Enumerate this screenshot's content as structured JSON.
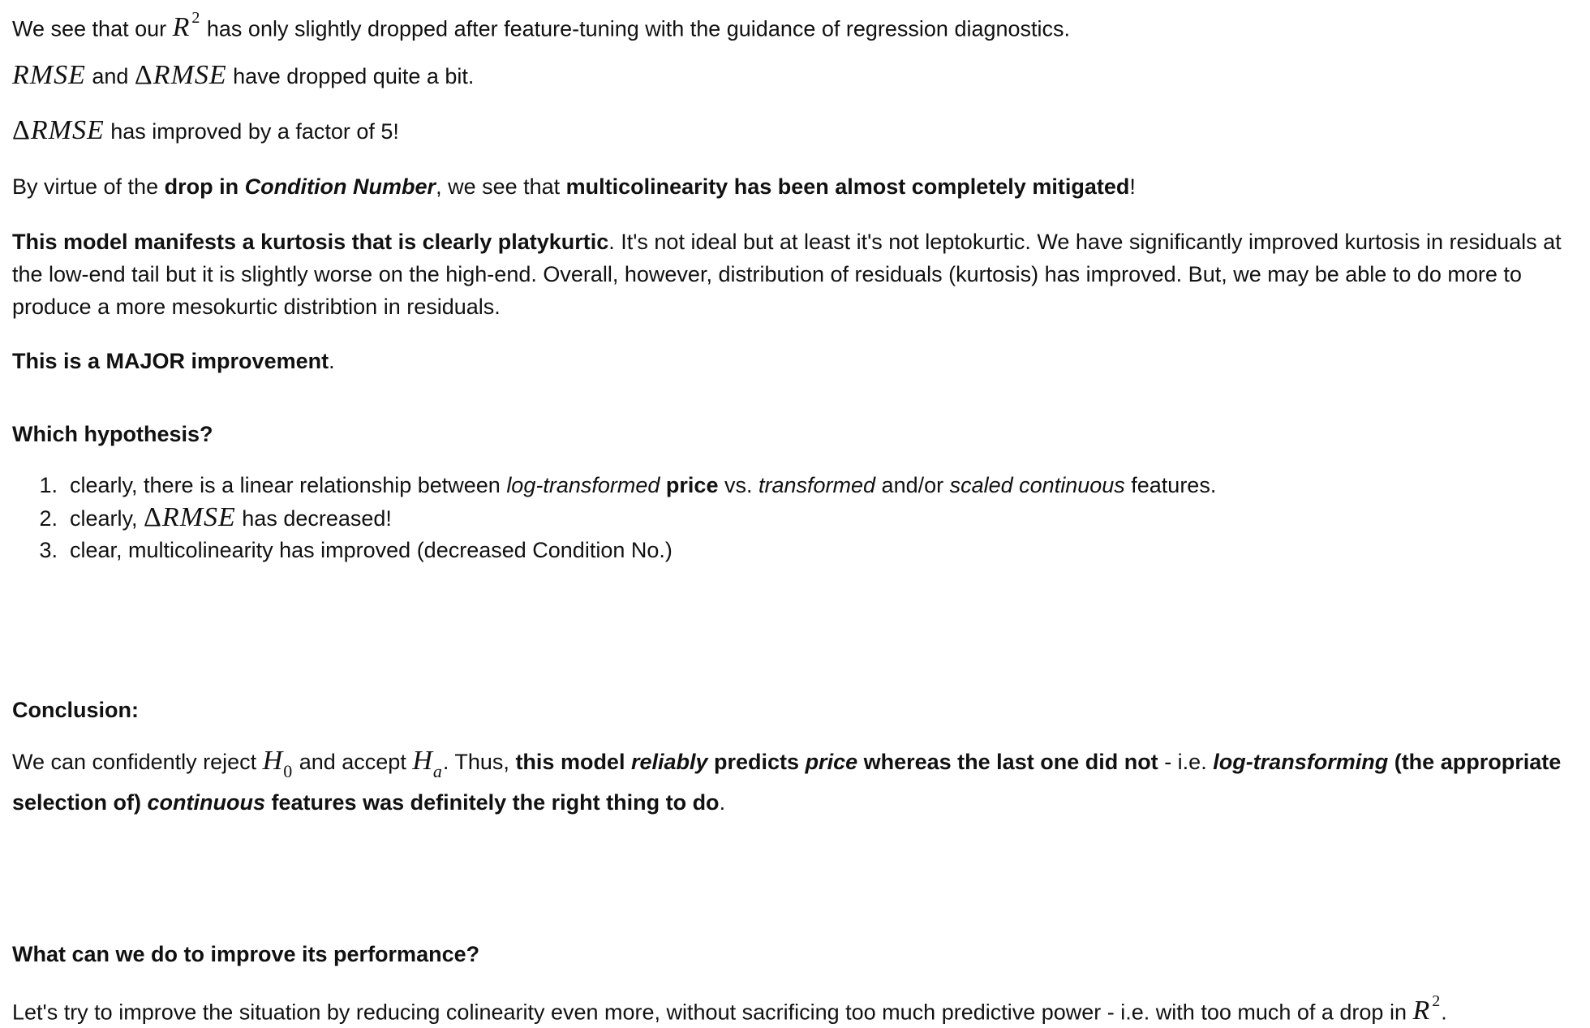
{
  "p1": {
    "t1": "We see that our ",
    "t2": " has only slightly dropped after feature-tuning with the guidance of regression diagnostics."
  },
  "p2": {
    "t1": " and ",
    "t2": " have dropped quite a bit."
  },
  "p3": {
    "t1": " has improved by a factor of 5!"
  },
  "p4": {
    "t1": "By virtue of the ",
    "b1": "drop in ",
    "bi1": "Condition Number",
    "t2": ", we see that ",
    "b2": "multicolinearity has been almost completely mitigated",
    "t3": "!"
  },
  "p5": {
    "b1": "This model manifests a kurtosis that is clearly platykurtic",
    "t1": ". It's not ideal but at least it's not leptokurtic. We have significantly improved kurtosis in residuals at the low-end tail but it is slightly worse on the high-end. Overall, however, distribution of residuals (kurtosis) has improved. But, we may be able to do more to produce a more mesokurtic distribtion in residuals."
  },
  "p6": {
    "b1": "This is a MAJOR improvement",
    "t1": "."
  },
  "hypothesis_heading": "Which hypothesis?",
  "hypotheses": {
    "n1": "1.",
    "n2": "2.",
    "n3": "3.",
    "item1": {
      "t1": "clearly, there is a linear relationship between ",
      "i1": "log-transformed",
      "t2": " ",
      "b1": "price",
      "t3": " vs. ",
      "i2": "transformed",
      "t4": " and/or ",
      "i3": "scaled continuous",
      "t5": " features."
    },
    "item2": {
      "t1": "clearly, ",
      "t2": " has decreased!"
    },
    "item3": {
      "t1": "clear, multicolinearity has improved (decreased Condition No.)"
    }
  },
  "conclusion_heading": "Conclusion:",
  "conclusion": {
    "t1": "We can confidently reject ",
    "t2": " and accept ",
    "t3": ". Thus, ",
    "b1": "this model ",
    "bi1": "reliably",
    "b2": " predicts ",
    "bi2": "price",
    "b3": " whereas the last one did not",
    "t4": " - i.e. ",
    "bi3": "log-transforming",
    "b4": " (the appropriate selection of) ",
    "bi4": "continuous",
    "b5": " features was definitely the right thing to do",
    "t5": "."
  },
  "improve_heading": "What can we do to improve its performance?",
  "improve": {
    "t1": "Let's try to improve the situation by reducing colinearity even more, without sacrificing too much predictive power - i.e. with too much of a drop in ",
    "t2": "."
  },
  "math": {
    "R": "R",
    "sq": "2",
    "RMSE": "RMSE",
    "delta": "Δ",
    "H": "H",
    "sub0": "0",
    "suba": "a"
  }
}
